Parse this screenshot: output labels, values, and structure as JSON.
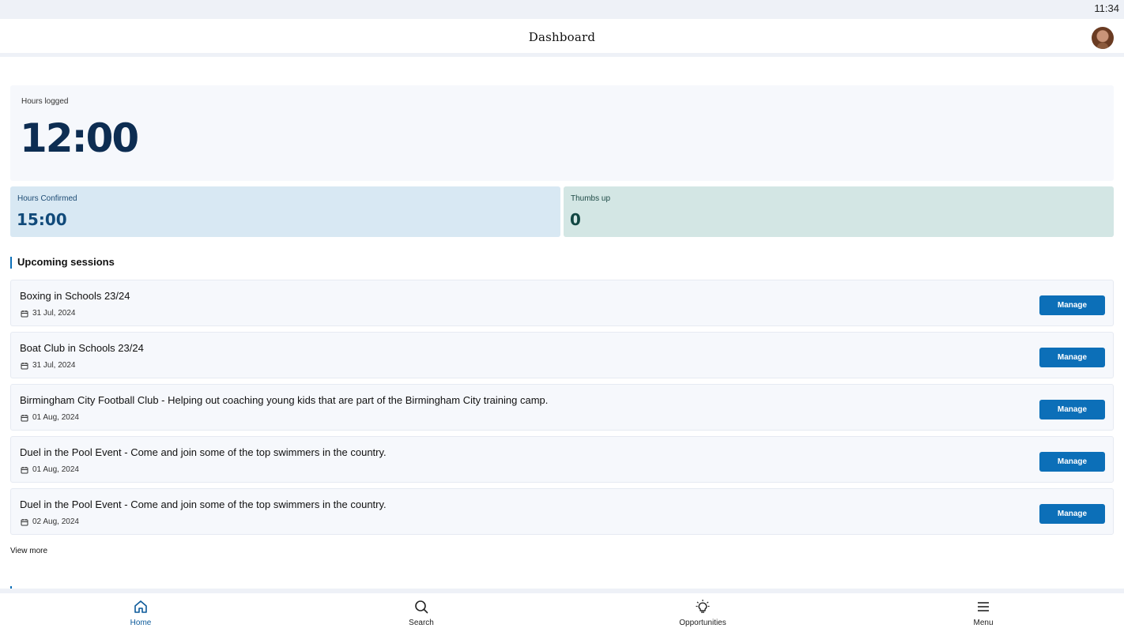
{
  "status_bar": {
    "time": "11:34"
  },
  "header": {
    "title": "Dashboard",
    "avatar_icon": "user-avatar"
  },
  "hours_logged": {
    "label": "Hours logged",
    "value": "12:00"
  },
  "stats": {
    "confirmed": {
      "label": "Hours Confirmed",
      "value": "15:00"
    },
    "thumbs_up": {
      "label": "Thumbs up",
      "value": "0"
    }
  },
  "upcoming": {
    "title": "Upcoming sessions",
    "button_label": "Manage",
    "sessions": [
      {
        "title": "Boxing in Schools 23/24",
        "date": "31 Jul, 2024"
      },
      {
        "title": "Boat Club in Schools 23/24",
        "date": "31 Jul, 2024"
      },
      {
        "title": "Birmingham City Football Club - Helping out coaching young kids that are part of the Birmingham City training camp.",
        "date": "01 Aug, 2024"
      },
      {
        "title": "Duel in the Pool Event - Come and join some of the top swimmers in the country.",
        "date": "01 Aug, 2024"
      },
      {
        "title": "Duel in the Pool Event - Come and join some of the top swimmers in the country.",
        "date": "02 Aug, 2024"
      }
    ],
    "view_more": "View more"
  },
  "bottom_nav": {
    "items": [
      {
        "label": "Home",
        "icon": "home-icon",
        "active": true
      },
      {
        "label": "Search",
        "icon": "search-icon"
      },
      {
        "label": "Opportunities",
        "icon": "lightbulb-icon"
      },
      {
        "label": "Menu",
        "icon": "menu-icon"
      }
    ]
  },
  "colors": {
    "accent": "#0c6fb8",
    "dark_navy": "#0d2d52",
    "confirmed_bg": "#d8e8f3",
    "thumbs_bg": "#d3e6e4"
  }
}
